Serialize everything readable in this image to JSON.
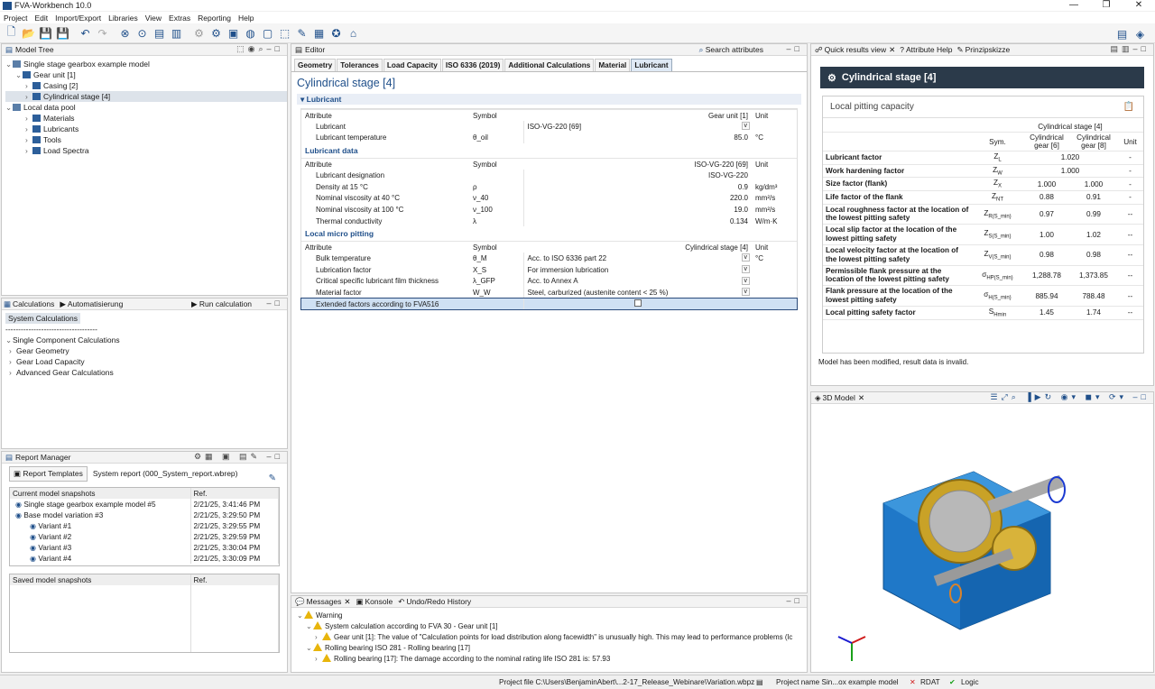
{
  "app": {
    "title": "FVA-Workbench 10.0"
  },
  "menu": [
    "Project",
    "Edit",
    "Import/Export",
    "Libraries",
    "View",
    "Extras",
    "Reporting",
    "Help"
  ],
  "model_tree": {
    "title": "Model Tree",
    "items": [
      {
        "label": "Single stage gearbox example model",
        "indent": 0
      },
      {
        "label": "Gear unit [1]",
        "indent": 1
      },
      {
        "label": "Casing [2]",
        "indent": 2
      },
      {
        "label": "Cylindrical stage [4]",
        "indent": 2,
        "selected": true
      },
      {
        "label": "Local data pool",
        "indent": 0
      },
      {
        "label": "Materials",
        "indent": 2
      },
      {
        "label": "Lubricants",
        "indent": 2
      },
      {
        "label": "Tools",
        "indent": 2
      },
      {
        "label": "Load Spectra",
        "indent": 2
      }
    ]
  },
  "calc": {
    "tab1": "Calculations",
    "tab2": "Automatisierung",
    "run": "Run calculation",
    "items": [
      {
        "label": "System Calculations",
        "selected": true
      },
      {
        "label": "------------------------------------"
      },
      {
        "label": "Single Component Calculations"
      },
      {
        "label": "Gear Geometry",
        "child": true
      },
      {
        "label": "Gear Load Capacity",
        "child": true
      },
      {
        "label": "Advanced Gear Calculations",
        "child": true
      }
    ]
  },
  "report": {
    "title": "Report Manager",
    "templates_btn": "Report Templates",
    "template_name": "System report (000_System_report.wbrep)",
    "current_header": "Current model snapshots",
    "ref_header": "Ref.",
    "snapshots": [
      {
        "name": "Single stage gearbox example model #5",
        "ref": "2/21/25, 3:41:46 PM",
        "indent": 0
      },
      {
        "name": "Base model variation #3",
        "ref": "2/21/25, 3:29:50 PM",
        "indent": 0
      },
      {
        "name": "Variant #1",
        "ref": "2/21/25, 3:29:55 PM",
        "indent": 1
      },
      {
        "name": "Variant #2",
        "ref": "2/21/25, 3:29:59 PM",
        "indent": 1
      },
      {
        "name": "Variant #3",
        "ref": "2/21/25, 3:30:04 PM",
        "indent": 1
      },
      {
        "name": "Variant #4",
        "ref": "2/21/25, 3:30:09 PM",
        "indent": 1
      }
    ],
    "saved_header": "Saved model snapshots",
    "saved_ref": "Ref."
  },
  "editor": {
    "tab": "Editor",
    "search": "Search attributes",
    "tabs": [
      "Geometry",
      "Tolerances",
      "Load Capacity",
      "ISO 6336 (2019)",
      "Additional Calculations",
      "Material",
      "Lubricant"
    ],
    "title": "Cylindrical stage [4]",
    "section": "Lubricant",
    "h_attr": "Attribute",
    "h_sym": "Symbol",
    "h_unit": "Unit",
    "g1": {
      "col": "Gear unit [1]",
      "rows": [
        {
          "a": "Lubricant",
          "s": "",
          "v": "ISO-VG-220 [69]",
          "u": "",
          "dd": true
        },
        {
          "a": "Lubricant temperature",
          "s": "θ_oil",
          "v": "85.0",
          "u": "°C",
          "num": true
        }
      ]
    },
    "g2": {
      "title": "Lubricant data",
      "col": "ISO-VG-220 [69]",
      "rows": [
        {
          "a": "Lubricant designation",
          "s": "",
          "v": "ISO-VG-220",
          "u": "",
          "num": true
        },
        {
          "a": "Density at 15 °C",
          "s": "ρ",
          "v": "0.9",
          "u": "kg/dm³",
          "num": true
        },
        {
          "a": "Nominal viscosity at 40 °C",
          "s": "ν_40",
          "v": "220.0",
          "u": "mm²/s",
          "num": true
        },
        {
          "a": "Nominal viscosity at 100 °C",
          "s": "ν_100",
          "v": "19.0",
          "u": "mm²/s",
          "num": true
        },
        {
          "a": "Thermal conductivity",
          "s": "λ",
          "v": "0.134",
          "u": "W/m·K",
          "num": true
        }
      ]
    },
    "g3": {
      "title": "Local micro pitting",
      "col": "Cylindrical stage [4]",
      "rows": [
        {
          "a": "Bulk temperature",
          "s": "θ_M",
          "v": "Acc. to ISO 6336 part 22",
          "u": "°C",
          "dd": true
        },
        {
          "a": "Lubrication factor",
          "s": "X_S",
          "v": "For immersion lubrication",
          "u": "",
          "dd": true
        },
        {
          "a": "Critical specific lubricant film thickness",
          "s": "λ_GFP",
          "v": "Acc. to Annex A",
          "u": "",
          "dd": true
        },
        {
          "a": "Material factor",
          "s": "W_W",
          "v": "Steel, carburized (austenite content < 25 %)",
          "u": "",
          "dd": true
        },
        {
          "a": "Extended factors according to FVA516",
          "s": "",
          "v": "",
          "u": "",
          "cb": true
        }
      ]
    }
  },
  "messages": {
    "tab1": "Messages",
    "tab2": "Konsole",
    "tab3": "Undo/Redo History",
    "lines": [
      {
        "t": "Warning",
        "lvl": 0
      },
      {
        "t": "System calculation according to FVA 30 - Gear unit [1]",
        "lvl": 1
      },
      {
        "t": "Gear unit [1]: The value of \"Calculation points for load distribution along facewidth\" is unusually high. This may lead to performance problems (lc",
        "lvl": 2
      },
      {
        "t": "Rolling bearing ISO 281 - Rolling bearing [17]",
        "lvl": 1
      },
      {
        "t": "Rolling bearing [17]: The damage according to the nominal rating life ISO 281 is: 57.93",
        "lvl": 2
      }
    ]
  },
  "quick": {
    "tab1": "Quick results view",
    "tab2": "Attribute Help",
    "tab3": "Prinzipskizze",
    "header": "Cylindrical stage [4]",
    "card": "Local pitting capacity",
    "col_group": "Cylindrical stage [4]",
    "col_sym": "Sym.",
    "col_g6": "Cylindrical gear [6]",
    "col_g8": "Cylindrical gear [8]",
    "col_unit": "Unit",
    "rows": [
      {
        "l": "Lubricant factor",
        "s": "Z",
        "sub": "L",
        "v": "1.020",
        "merged": true,
        "u": "-"
      },
      {
        "l": "Work hardening factor",
        "s": "Z",
        "sub": "W",
        "v": "1.000",
        "merged": true,
        "u": "-"
      },
      {
        "l": "Size factor (flank)",
        "s": "Z",
        "sub": "X",
        "v1": "1.000",
        "v2": "1.000",
        "u": "-"
      },
      {
        "l": "Life factor of the flank",
        "s": "Z",
        "sub": "NT",
        "v1": "0.88",
        "v2": "0.91",
        "u": "-"
      },
      {
        "l": "Local roughness factor at the location of the lowest pitting safety",
        "s": "Z",
        "sub": "R(S_min)",
        "v1": "0.97",
        "v2": "0.99",
        "u": "--"
      },
      {
        "l": "Local slip factor at the location of the lowest pitting safety",
        "s": "Z",
        "sub": "S(S_min)",
        "v1": "1.00",
        "v2": "1.02",
        "u": "--"
      },
      {
        "l": "Local velocity factor at the location of the lowest pitting safety",
        "s": "Z",
        "sub": "V(S_min)",
        "v1": "0.98",
        "v2": "0.98",
        "u": "--"
      },
      {
        "l": "Permissible flank pressure at the location of the lowest pitting safety",
        "s": "σ",
        "sub": "HP(S_min)",
        "v1": "1,288.78",
        "v2": "1,373.85",
        "u": "--"
      },
      {
        "l": "Flank pressure at the location of the lowest pitting safety",
        "s": "σ",
        "sub": "H(S_min)",
        "v1": "885.94",
        "v2": "788.48",
        "u": "--"
      },
      {
        "l": "Local pitting safety factor",
        "s": "S",
        "sub": "Hmin",
        "v1": "1.45",
        "v2": "1.74",
        "u": "--"
      }
    ],
    "notice": "Model has been modified, result data is invalid."
  },
  "model3d": {
    "tab": "3D Model"
  },
  "status": {
    "file": "Project file C:\\Users\\BenjaminAbert\\...2-17_Release_Webinare\\Variation.wbpz",
    "name": "Project name Sin...ox example model",
    "rdat": "RDAT",
    "logic": "Logic"
  },
  "colors": {
    "accent": "#1f4f8a",
    "header_dark": "#2b3a4a",
    "gear_gold": "#c9a227",
    "casing_blue": "#1f78c8"
  }
}
